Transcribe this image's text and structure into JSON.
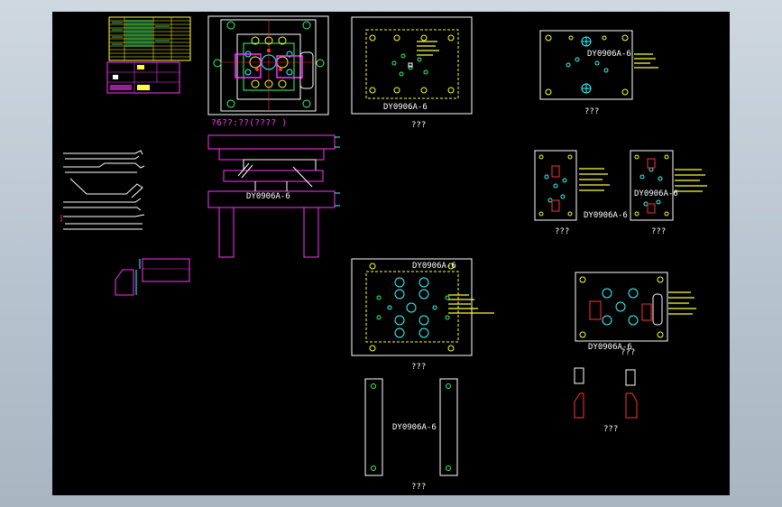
{
  "colors": {
    "background": "#000000",
    "frame": "#c8d2dc",
    "white": "#ffffff",
    "yellow": "#ffff33",
    "green": "#33ff66",
    "cyan": "#33ffff",
    "magenta": "#ff33ff",
    "red": "#ff3333"
  },
  "labels": {
    "layout_caption": "?6??:??(????  )",
    "part_code": "DY0906A-6",
    "qqq": "???"
  }
}
